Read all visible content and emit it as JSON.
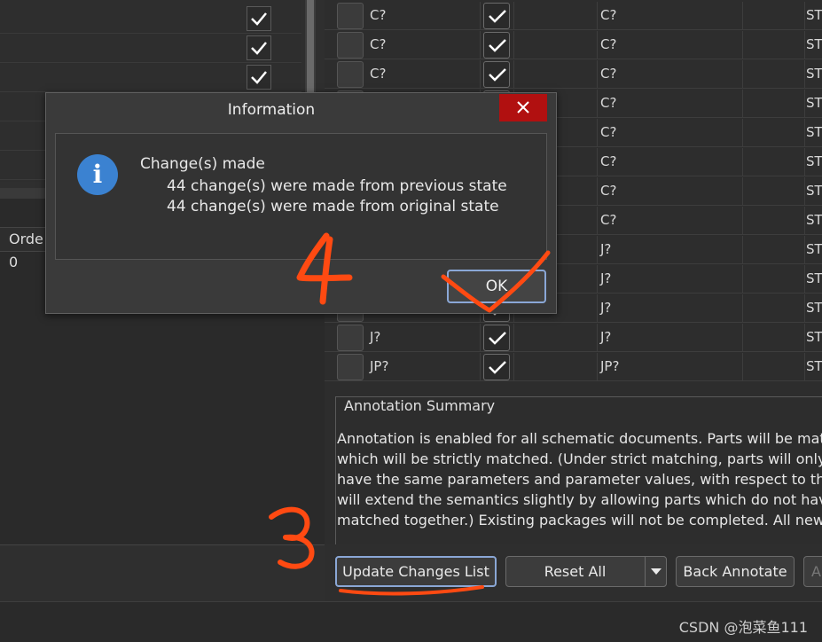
{
  "left_panel": {
    "order_header": "Orde",
    "order_value": "0"
  },
  "table": {
    "rows": [
      {
        "designator": "C?",
        "proposed": "C?",
        "location": "ST",
        "checked": true
      },
      {
        "designator": "C?",
        "proposed": "C?",
        "location": "ST",
        "checked": true
      },
      {
        "designator": "C?",
        "proposed": "C?",
        "location": "ST",
        "checked": true
      },
      {
        "designator": "",
        "proposed": "C?",
        "location": "ST",
        "checked": true
      },
      {
        "designator": "",
        "proposed": "C?",
        "location": "ST",
        "checked": true
      },
      {
        "designator": "",
        "proposed": "C?",
        "location": "ST",
        "checked": true
      },
      {
        "designator": "",
        "proposed": "C?",
        "location": "ST",
        "checked": true
      },
      {
        "designator": "",
        "proposed": "C?",
        "location": "ST",
        "checked": true
      },
      {
        "designator": "",
        "proposed": "J?",
        "location": "ST",
        "checked": true
      },
      {
        "designator": "",
        "proposed": "J?",
        "location": "ST",
        "checked": true
      },
      {
        "designator": "",
        "proposed": "J?",
        "location": "ST",
        "checked": true
      },
      {
        "designator": "J?",
        "proposed": "J?",
        "location": "ST",
        "checked": true
      },
      {
        "designator": "JP?",
        "proposed": "JP?",
        "location": "ST",
        "checked": true
      }
    ]
  },
  "summary": {
    "title": "Annotation Summary",
    "lines": [
      "Annotation is enabled for all schematic documents. Parts will be matche",
      "which will be strictly matched. (Under strict matching, parts will only be r",
      "have the same parameters and parameter values, with respect to the ma",
      "will extend the semantics slightly by allowing parts which do not have th",
      "matched together.) Existing packages will not be completed. All new par"
    ]
  },
  "buttons": {
    "update": "Update Changes List",
    "reset": "Reset All",
    "back_annotate": "Back Annotate",
    "more": "A"
  },
  "dialog": {
    "title": "Information",
    "message_title": "Change(s) made",
    "line1": "44 change(s) were made from previous state",
    "line2": "44 change(s) were made from original state",
    "ok": "OK",
    "icon": "info-icon"
  },
  "annotations": {
    "step_ok": "4",
    "step_update": "3"
  },
  "watermark": "CSDN @泡菜鱼111",
  "colors": {
    "close_red": "#b11010",
    "info_blue": "#3b82d1",
    "annotation_orange": "#ff4a12",
    "focus_border": "#8aa7d6"
  }
}
